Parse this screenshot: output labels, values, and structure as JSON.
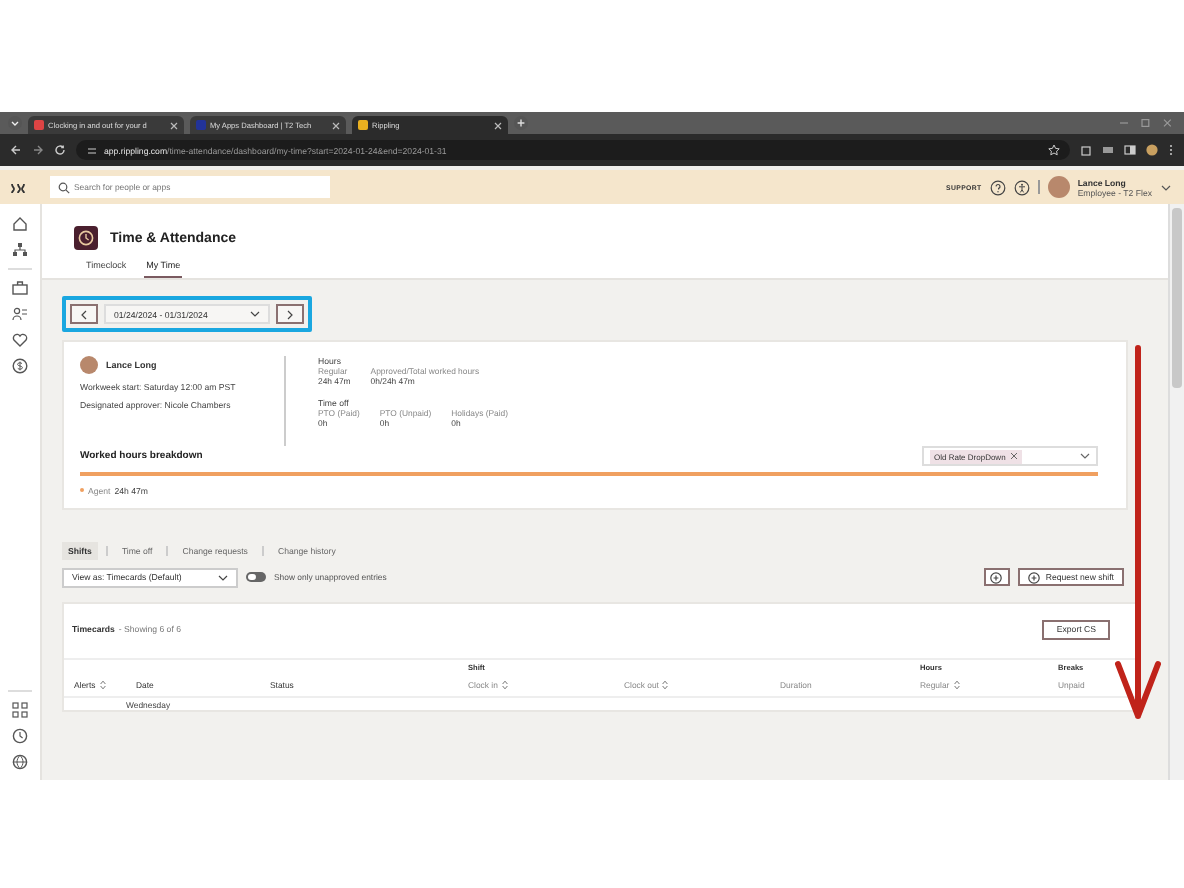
{
  "browser": {
    "tabs": [
      {
        "title": "Clocking in and out for your d",
        "selected": false
      },
      {
        "title": "My Apps Dashboard | T2 Tech",
        "selected": false
      },
      {
        "title": "Rippling",
        "selected": true
      }
    ],
    "url_host": "app.rippling.com",
    "url_path": "/time-attendance/dashboard/my-time?start=2024-01-24&end=2024-01-31"
  },
  "app_header": {
    "search": {
      "placeholder": "Search for people or apps"
    },
    "support": "SUPPORT",
    "user": {
      "name": "Lance Long",
      "role": "Employee - T2 Flex"
    }
  },
  "page": {
    "title": "Time & Attendance",
    "tabs": [
      {
        "label": "Timeclock",
        "selected": false
      },
      {
        "label": "My Time",
        "selected": true
      }
    ]
  },
  "date_range": "01/24/2024 - 01/31/2024",
  "summary": {
    "name": "Lance Long",
    "workweek": "Workweek start: Saturday 12:00 am PST",
    "approver": "Designated approver: Nicole Chambers",
    "hours_title": "Hours",
    "hours": [
      {
        "label": "Regular",
        "value": "24h 47m"
      },
      {
        "label": "Approved/Total worked hours",
        "value": "0h/24h 47m"
      }
    ],
    "timeoff_title": "Time off",
    "timeoff": [
      {
        "label": "PTO (Paid)",
        "value": "0h"
      },
      {
        "label": "PTO (Unpaid)",
        "value": "0h"
      },
      {
        "label": "Holidays (Paid)",
        "value": "0h"
      }
    ]
  },
  "breakdown": {
    "title": "Worked hours breakdown",
    "filter_chip": "Old Rate DropDown",
    "legend": [
      {
        "label": "Agent",
        "value": "24h 47m",
        "color": "#f0a060"
      }
    ]
  },
  "section_tabs": [
    {
      "label": "Shifts",
      "selected": true
    },
    {
      "label": "Time off",
      "selected": false
    },
    {
      "label": "Change requests",
      "selected": false
    },
    {
      "label": "Change history",
      "selected": false
    }
  ],
  "view_as": "View as: Timecards (Default)",
  "unapproved_toggle": {
    "label": "Show only unapproved entries",
    "on": false
  },
  "request_button": "Request new shift",
  "timecards": {
    "title": "Timecards",
    "count": "- Showing 6 of 6",
    "export": "Export CS",
    "columns": [
      {
        "label": "Alerts",
        "sortable": true,
        "primary": true
      },
      {
        "label": "Date",
        "sortable": false,
        "primary": true
      },
      {
        "label": "Status",
        "sortable": false,
        "primary": true
      },
      {
        "group": "Shift",
        "label": "Clock in",
        "sortable": true,
        "primary": false
      },
      {
        "label": "Clock out",
        "sortable": true,
        "primary": false
      },
      {
        "label": "Duration",
        "sortable": false,
        "primary": false
      },
      {
        "group": "Hours",
        "label": "Regular",
        "sortable": true,
        "primary": false
      },
      {
        "group": "Breaks",
        "label": "Unpaid",
        "sortable": false,
        "primary": false
      }
    ],
    "rows": [
      {
        "date": "Wednesday"
      }
    ]
  }
}
